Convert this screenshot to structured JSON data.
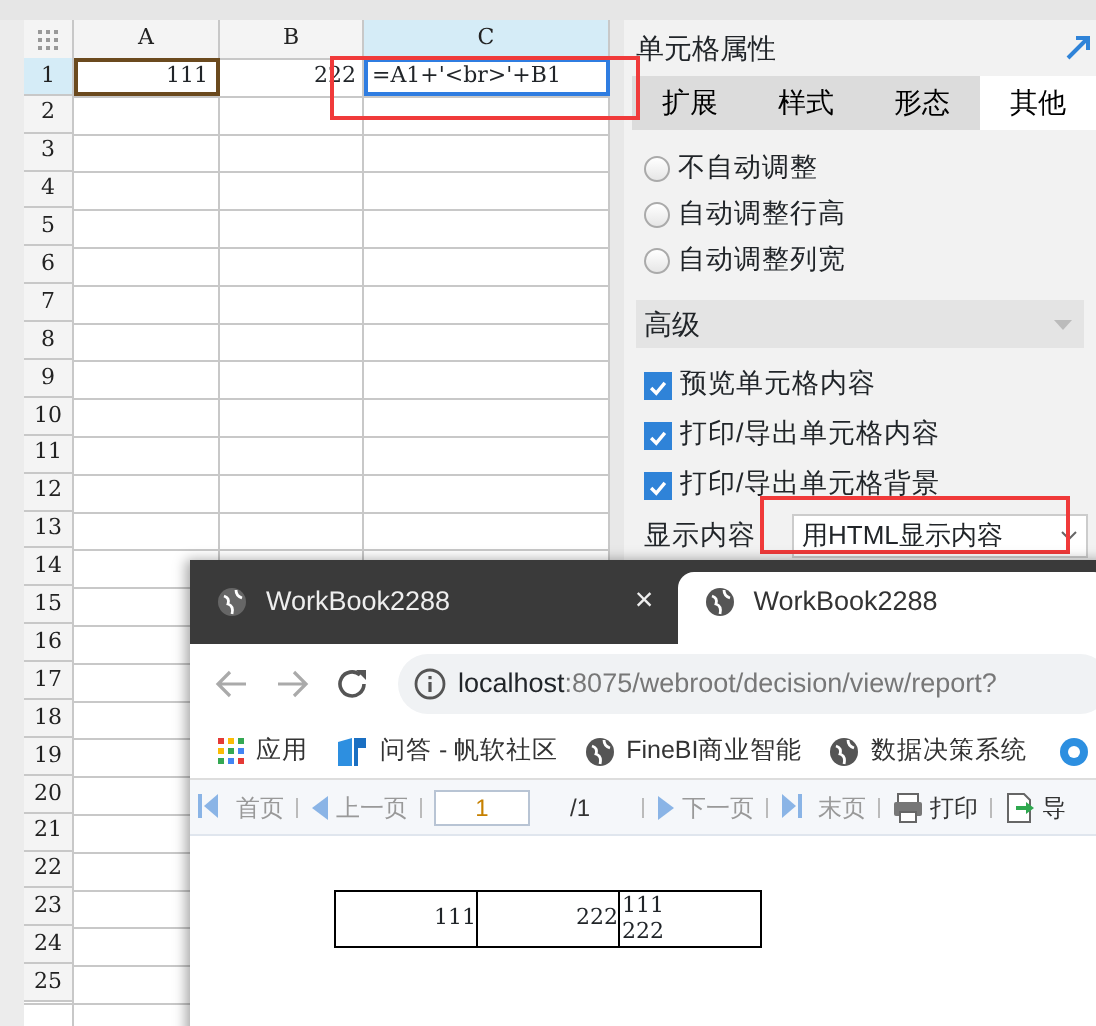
{
  "spreadsheet": {
    "columns": [
      {
        "label": "A",
        "selected": false
      },
      {
        "label": "B",
        "selected": false
      },
      {
        "label": "C",
        "selected": true
      }
    ],
    "rows": [
      {
        "label": "1",
        "selected": true,
        "cells": [
          "111",
          "222",
          "=A1+'<br>'+B1"
        ],
        "highlighted": true
      },
      {
        "label": "2",
        "selected": false
      },
      {
        "label": "3",
        "selected": false
      },
      {
        "label": "4",
        "selected": false
      },
      {
        "label": "5",
        "selected": false
      },
      {
        "label": "6",
        "selected": false
      },
      {
        "label": "7",
        "selected": false
      },
      {
        "label": "8",
        "selected": false
      },
      {
        "label": "9",
        "selected": false
      },
      {
        "label": "10",
        "selected": false
      },
      {
        "label": "11",
        "selected": false
      },
      {
        "label": "12",
        "selected": false
      },
      {
        "label": "13",
        "selected": false
      },
      {
        "label": "14",
        "selected": false
      },
      {
        "label": "15",
        "selected": false
      },
      {
        "label": "16",
        "selected": false
      },
      {
        "label": "17",
        "selected": false
      },
      {
        "label": "18",
        "selected": false
      },
      {
        "label": "19",
        "selected": false
      },
      {
        "label": "20",
        "selected": false
      },
      {
        "label": "21",
        "selected": false
      },
      {
        "label": "22",
        "selected": false
      },
      {
        "label": "23",
        "selected": false
      },
      {
        "label": "24",
        "selected": false
      },
      {
        "label": "25",
        "selected": false
      }
    ]
  },
  "panel": {
    "title": "单元格属性",
    "tabs": [
      {
        "label": "扩展",
        "selected": false
      },
      {
        "label": "样式",
        "selected": false
      },
      {
        "label": "形态",
        "selected": false
      },
      {
        "label": "其他",
        "selected": true
      }
    ],
    "radios": [
      {
        "label": "不自动调整",
        "selected": false
      },
      {
        "label": "自动调整行高",
        "selected": false
      },
      {
        "label": "自动调整列宽",
        "selected": false
      }
    ],
    "section": "高级",
    "checkboxes": [
      {
        "label": "预览单元格内容",
        "checked": true
      },
      {
        "label": "打印/导出单元格内容",
        "checked": true
      },
      {
        "label": "打印/导出单元格背景",
        "checked": true
      }
    ],
    "display": {
      "label": "显示内容",
      "value": "用HTML显示内容",
      "highlighted": true
    }
  },
  "browser": {
    "tabs": [
      {
        "title": "WorkBook2288",
        "selected": false,
        "close": "×"
      },
      {
        "title": "WorkBook2288",
        "selected": true
      }
    ],
    "url_host": "localhost",
    "url_rest": ":8075/webroot/decision/view/report?",
    "bookmarks": [
      {
        "kind": "apps",
        "label": "应用"
      },
      {
        "kind": "brand",
        "label": "问答 - 帆软社区"
      },
      {
        "kind": "globe",
        "label": "FineBI商业智能"
      },
      {
        "kind": "globe",
        "label": "数据决策系统"
      }
    ],
    "toolbar": [
      {
        "kind": "first",
        "label": "首页"
      },
      {
        "kind": "prev",
        "label": "上一页"
      },
      {
        "kind": "page",
        "value": "1",
        "total": "/1"
      },
      {
        "kind": "next",
        "label": "下一页"
      },
      {
        "kind": "last",
        "label": "末页"
      },
      {
        "kind": "print",
        "label": "打印"
      },
      {
        "kind": "export",
        "label": "导"
      }
    ],
    "report": [
      "111",
      "222",
      "111\n222"
    ]
  }
}
